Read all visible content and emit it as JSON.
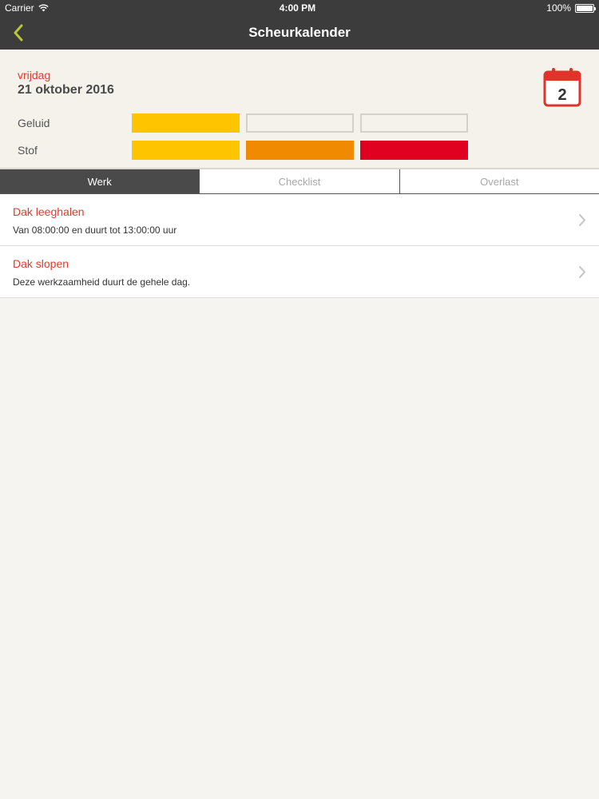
{
  "statusbar": {
    "carrier": "Carrier",
    "time": "4:00 PM",
    "battery": "100%"
  },
  "navbar": {
    "title": "Scheurkalender",
    "back_icon": "chevron-left-icon",
    "accent_color": "#b8c832"
  },
  "header": {
    "day": "vrijdag",
    "date": "21 oktober 2016",
    "calendar_icon": "calendar-icon",
    "calendar_number": "2",
    "rows": [
      {
        "label": "Geluid",
        "level": 1,
        "max": 3
      },
      {
        "label": "Stof",
        "level": 3,
        "max": 3
      }
    ],
    "level_colors": [
      "#ffc400",
      "#f08a00",
      "#e00020"
    ]
  },
  "tabs": [
    {
      "label": "Werk",
      "active": true
    },
    {
      "label": "Checklist",
      "active": false
    },
    {
      "label": "Overlast",
      "active": false
    }
  ],
  "items": [
    {
      "title": "Dak leeghalen",
      "subtitle": "Van 08:00:00 en duurt tot 13:00:00 uur"
    },
    {
      "title": "Dak slopen",
      "subtitle": "Deze werkzaamheid duurt de gehele dag."
    }
  ]
}
